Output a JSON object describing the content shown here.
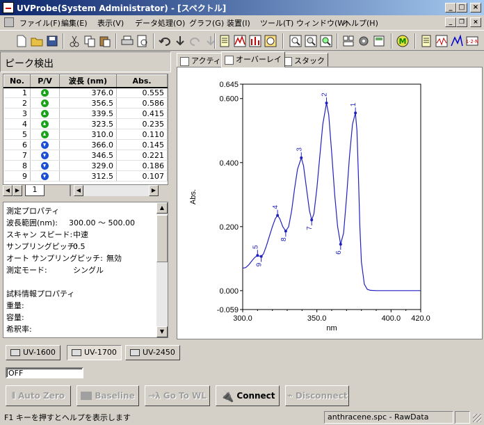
{
  "window": {
    "title": "UVProbe(System Administrator) - [スペクトル]"
  },
  "caption_buttons": {
    "minimize": "_",
    "maximize": "□",
    "close": "×"
  },
  "menu": [
    "ファイル(F)",
    "編集(E)",
    "表示(V)",
    "データ処理(O)",
    "グラフ(G)",
    "装置(I)",
    "ツール(T)",
    "ウィンドウ(W)",
    "ヘルプ(H)"
  ],
  "toolbar_icons": [
    "new-file-icon",
    "open-folder-icon",
    "save-icon",
    "cut-icon",
    "copy-icon",
    "paste-icon",
    "print-icon",
    "print-preview-icon",
    "undo-icon",
    "redo-icon",
    "properties-icon",
    "peak-pick-icon",
    "zoom-in-icon",
    "zoom-out-icon",
    "zoom-all-icon",
    "m-icon"
  ],
  "peak_panel": {
    "title": "ピーク検出",
    "columns": [
      "No.",
      "P/V",
      "波長 (nm)",
      "Abs."
    ],
    "rows": [
      {
        "no": "1",
        "type": "peak",
        "wl": "376.0",
        "abs": "0.555"
      },
      {
        "no": "2",
        "type": "peak",
        "wl": "356.5",
        "abs": "0.586"
      },
      {
        "no": "3",
        "type": "peak",
        "wl": "339.5",
        "abs": "0.415"
      },
      {
        "no": "4",
        "type": "peak",
        "wl": "323.5",
        "abs": "0.235"
      },
      {
        "no": "5",
        "type": "peak",
        "wl": "310.0",
        "abs": "0.110"
      },
      {
        "no": "6",
        "type": "valley",
        "wl": "366.0",
        "abs": "0.145"
      },
      {
        "no": "7",
        "type": "valley",
        "wl": "346.5",
        "abs": "0.221"
      },
      {
        "no": "8",
        "type": "valley",
        "wl": "329.0",
        "abs": "0.186"
      },
      {
        "no": "9",
        "type": "valley",
        "wl": "312.5",
        "abs": "0.107"
      }
    ],
    "sheet_tab": "1"
  },
  "properties": {
    "lines": [
      {
        "k": "測定プロパティ",
        "v": ""
      },
      {
        "k": "波長範囲(nm):",
        "v": "300.00 ～ 500.00"
      },
      {
        "k": "スキャン スピード:",
        "v": "中速"
      },
      {
        "k": "サンプリングピッチ:",
        "v": "0.5"
      },
      {
        "k": "オート サンプリングピッチ:",
        "v": "無効"
      },
      {
        "k": "測定モード:",
        "v": "シングル"
      },
      {
        "k": "",
        "v": ""
      },
      {
        "k": "試料情報プロパティ",
        "v": ""
      },
      {
        "k": "重量:",
        "v": ""
      },
      {
        "k": "容量:",
        "v": ""
      },
      {
        "k": "希釈率:",
        "v": ""
      }
    ]
  },
  "graph_tabs": [
    "アクティブ",
    "オーバーレイ",
    "スタック"
  ],
  "chart_data": {
    "type": "line",
    "title": "",
    "xlabel": "nm",
    "ylabel": "Abs.",
    "xlim": [
      300.0,
      420.0
    ],
    "ylim": [
      -0.059,
      0.645
    ],
    "x_ticks": [
      "300.0",
      "350.0",
      "400.0",
      "420.0"
    ],
    "x_tick_values": [
      300,
      350,
      400,
      420
    ],
    "y_ticks": [
      "0.645",
      "0.600",
      "0.400",
      "0.200",
      "0.000",
      "-0.059"
    ],
    "y_tick_values": [
      0.645,
      0.6,
      0.4,
      0.2,
      0.0,
      -0.059
    ],
    "series": [
      {
        "color": "#2020c0",
        "x": [
          300,
          302,
          304,
          306,
          308,
          310,
          311,
          312.5,
          314,
          316,
          318,
          320,
          322,
          323.5,
          325,
          327,
          329,
          331,
          333,
          335,
          337,
          339.5,
          341,
          343,
          345,
          346.5,
          348,
          350,
          352,
          354,
          356.5,
          358,
          360,
          362,
          364,
          366,
          368,
          370,
          372,
          374,
          376,
          377,
          378,
          379,
          380,
          382,
          384,
          386,
          390,
          395,
          400,
          405,
          410,
          415,
          420
        ],
        "y": [
          0.07,
          0.072,
          0.08,
          0.092,
          0.103,
          0.11,
          0.108,
          0.107,
          0.115,
          0.14,
          0.17,
          0.2,
          0.225,
          0.235,
          0.225,
          0.2,
          0.186,
          0.2,
          0.25,
          0.32,
          0.38,
          0.415,
          0.39,
          0.32,
          0.25,
          0.221,
          0.24,
          0.32,
          0.42,
          0.52,
          0.586,
          0.55,
          0.43,
          0.3,
          0.2,
          0.145,
          0.18,
          0.29,
          0.42,
          0.52,
          0.555,
          0.5,
          0.36,
          0.2,
          0.09,
          0.02,
          0.004,
          0.001,
          0.0,
          0.0,
          0.0,
          0.0,
          0.0,
          0.0,
          0.0
        ]
      }
    ],
    "peak_labels": [
      {
        "label": "1",
        "x": 376.0,
        "y": 0.555,
        "kind": "peak"
      },
      {
        "label": "2",
        "x": 356.5,
        "y": 0.586,
        "kind": "peak"
      },
      {
        "label": "3",
        "x": 339.5,
        "y": 0.415,
        "kind": "peak"
      },
      {
        "label": "4",
        "x": 323.5,
        "y": 0.235,
        "kind": "peak"
      },
      {
        "label": "5",
        "x": 310.0,
        "y": 0.11,
        "kind": "peak"
      },
      {
        "label": "6",
        "x": 366.0,
        "y": 0.145,
        "kind": "valley"
      },
      {
        "label": "7",
        "x": 346.5,
        "y": 0.221,
        "kind": "valley"
      },
      {
        "label": "8",
        "x": 329.0,
        "y": 0.186,
        "kind": "valley"
      },
      {
        "label": "9",
        "x": 312.5,
        "y": 0.107,
        "kind": "valley"
      }
    ],
    "grid": false,
    "legend": "none"
  },
  "instrument_tabs": [
    "UV-1600",
    "UV-1700",
    "UV-2450"
  ],
  "status_field": "OFF",
  "commands": {
    "auto_zero": "Auto Zero",
    "baseline": "Baseline",
    "go_to_wl": "Go To WL",
    "connect": "Connect",
    "disconnect": "Disconnect"
  },
  "statusbar": {
    "help": "F1 キーを押すとヘルプを表示します",
    "file": "anthracene.spc - RawData"
  },
  "colors": {
    "title_gradient_start": "#0a246a",
    "title_gradient_end": "#a6caf0",
    "face": "#d4d0c8",
    "spectrum": "#2020c0",
    "peak_icon": "#1aa31a",
    "valley_icon": "#1a4fd6"
  }
}
